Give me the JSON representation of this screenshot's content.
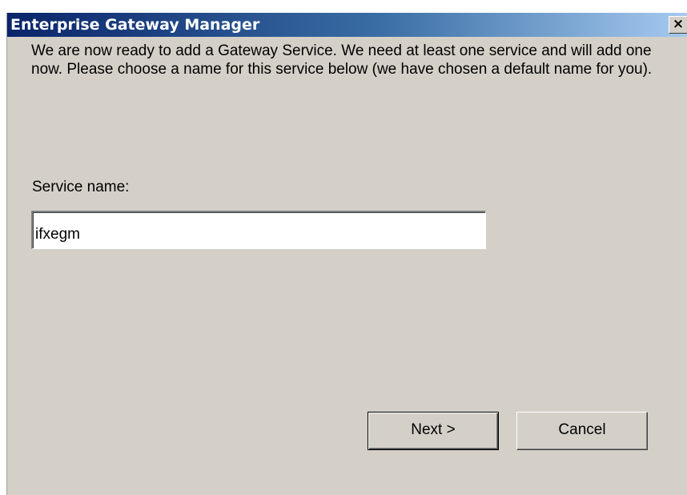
{
  "window": {
    "title": "Enterprise Gateway Manager",
    "close_glyph": "×",
    "close_icon": "close-icon"
  },
  "content": {
    "message": "We are now ready to add a Gateway Service.  We need at least one service and will add one now.  Please choose a name for this service below (we have chosen a default name for you).",
    "service_name_label": "Service name:",
    "service_name_value": "ifxegm"
  },
  "buttons": {
    "next_label": "Next >",
    "cancel_label": "Cancel"
  },
  "colors": {
    "title_bar_start": "#0a246a",
    "title_bar_end": "#a6caf0",
    "dialog_background": "#d4d0c8"
  }
}
